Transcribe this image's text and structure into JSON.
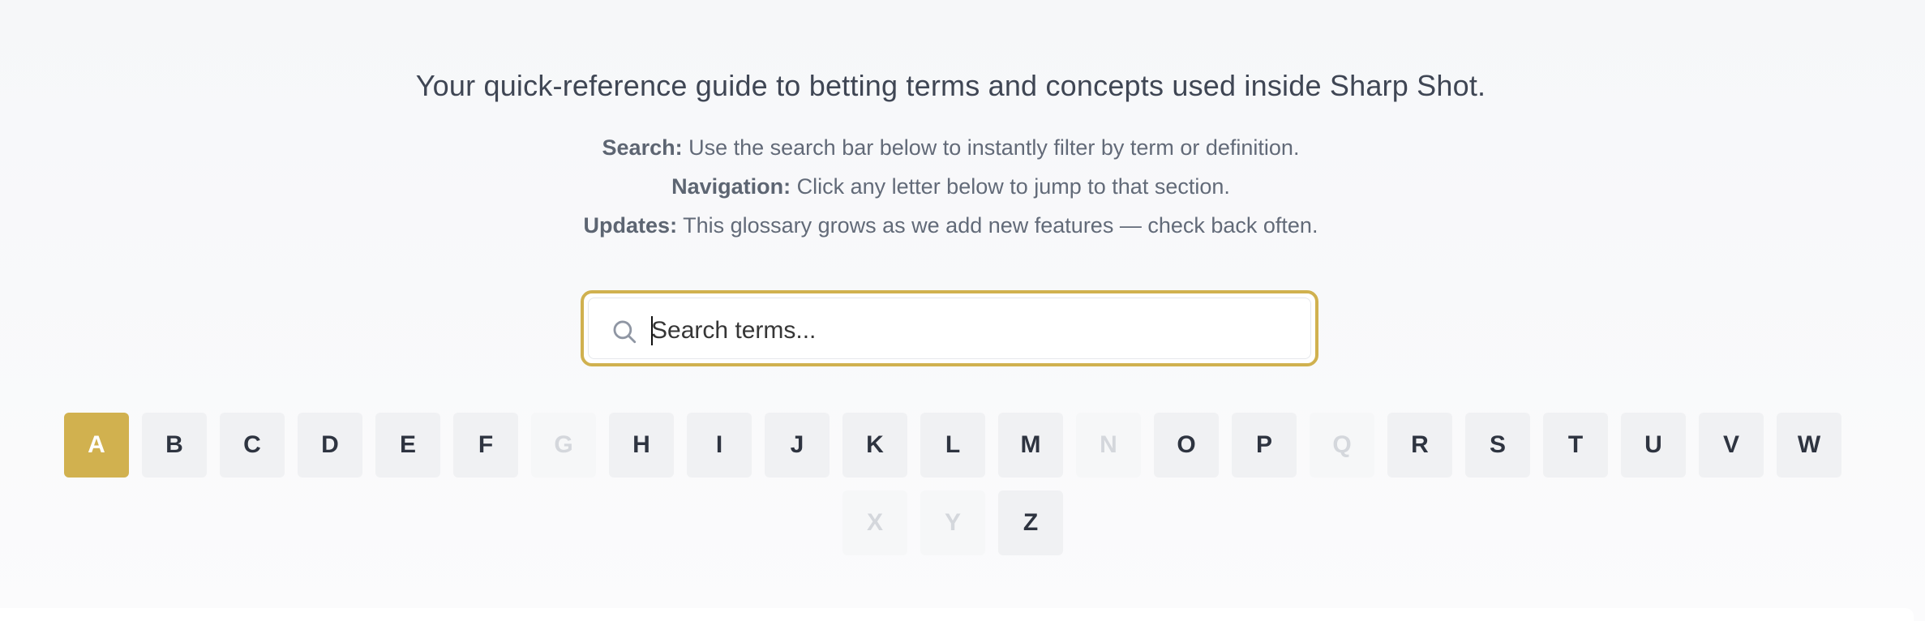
{
  "intro": {
    "tagline": "Your quick-reference guide to betting terms and concepts used inside Sharp Shot.",
    "help": [
      {
        "label": "Search:",
        "text": " Use the search bar below to instantly filter by term or definition."
      },
      {
        "label": "Navigation:",
        "text": " Click any letter below to jump to that section."
      },
      {
        "label": "Updates:",
        "text": " This glossary grows as we add new features — check back often."
      }
    ]
  },
  "search": {
    "placeholder": "Search terms...",
    "value": "",
    "icon": "search-icon"
  },
  "alphabet": {
    "selected": "A",
    "letters": [
      {
        "letter": "A",
        "state": "active"
      },
      {
        "letter": "B",
        "state": "enabled"
      },
      {
        "letter": "C",
        "state": "enabled"
      },
      {
        "letter": "D",
        "state": "enabled"
      },
      {
        "letter": "E",
        "state": "enabled"
      },
      {
        "letter": "F",
        "state": "enabled"
      },
      {
        "letter": "G",
        "state": "disabled"
      },
      {
        "letter": "H",
        "state": "enabled"
      },
      {
        "letter": "I",
        "state": "enabled"
      },
      {
        "letter": "J",
        "state": "enabled"
      },
      {
        "letter": "K",
        "state": "enabled"
      },
      {
        "letter": "L",
        "state": "enabled"
      },
      {
        "letter": "M",
        "state": "enabled"
      },
      {
        "letter": "N",
        "state": "disabled"
      },
      {
        "letter": "O",
        "state": "enabled"
      },
      {
        "letter": "P",
        "state": "enabled"
      },
      {
        "letter": "Q",
        "state": "disabled"
      },
      {
        "letter": "R",
        "state": "enabled"
      },
      {
        "letter": "S",
        "state": "enabled"
      },
      {
        "letter": "T",
        "state": "enabled"
      },
      {
        "letter": "U",
        "state": "enabled"
      },
      {
        "letter": "V",
        "state": "enabled"
      },
      {
        "letter": "W",
        "state": "enabled"
      },
      {
        "letter": "X",
        "state": "disabled"
      },
      {
        "letter": "Y",
        "state": "disabled"
      },
      {
        "letter": "Z",
        "state": "enabled"
      }
    ]
  },
  "colors": {
    "accent": "#d1b14f",
    "letter_bg": "#f0f1f3",
    "letter_text": "#2e3440",
    "disabled_text": "#d4d7dc",
    "tagline_text": "#3f4654",
    "help_text": "#626a78"
  }
}
